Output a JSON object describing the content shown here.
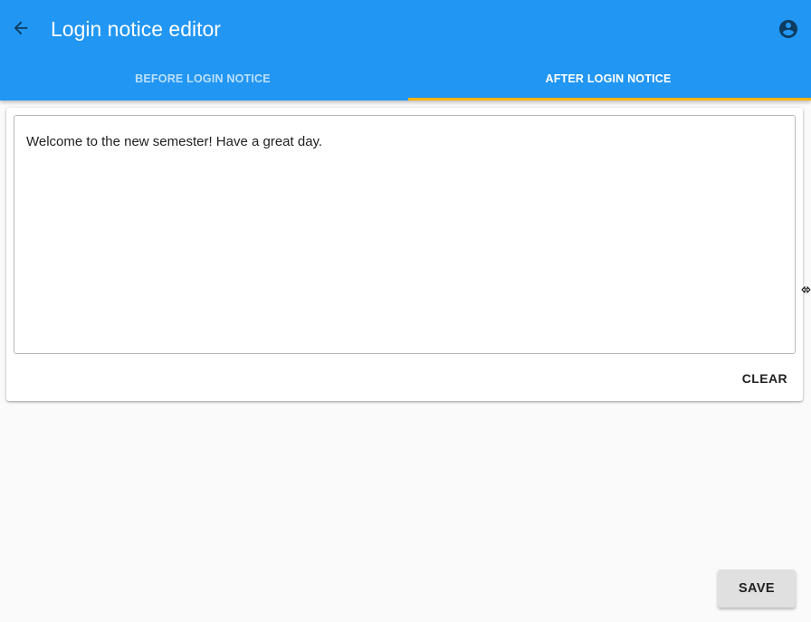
{
  "app_bar": {
    "title": "Login notice editor",
    "back_icon": "arrow-left-icon",
    "account_icon": "account-circle-icon",
    "background_color": "#2196f3"
  },
  "tabs": [
    {
      "label": "BEFORE LOGIN NOTICE",
      "active": false
    },
    {
      "label": "AFTER LOGIN NOTICE",
      "active": true
    }
  ],
  "tab_indicator_color": "#ffb300",
  "editor": {
    "value": "Welcome to the new semester! Have a great day.",
    "clear_label": "CLEAR"
  },
  "save_label": "SAVE"
}
